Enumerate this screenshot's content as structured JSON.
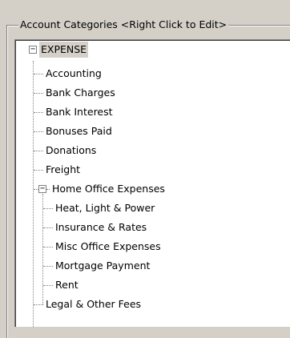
{
  "groupbox": {
    "title": "Account Categories  <Right Click to Edit>"
  },
  "tree": {
    "root": {
      "label": "EXPENSE",
      "expander": "−"
    },
    "items": [
      "Accounting",
      "Bank Charges",
      "Bank Interest",
      "Bonuses Paid",
      "Donations",
      "Freight"
    ],
    "home_office": {
      "label": "Home Office Expenses",
      "expander": "−",
      "children": [
        "Heat, Light & Power",
        "Insurance & Rates",
        "Misc Office Expenses",
        "Mortgage Payment",
        "Rent"
      ]
    },
    "after": [
      "Legal & Other Fees"
    ]
  }
}
